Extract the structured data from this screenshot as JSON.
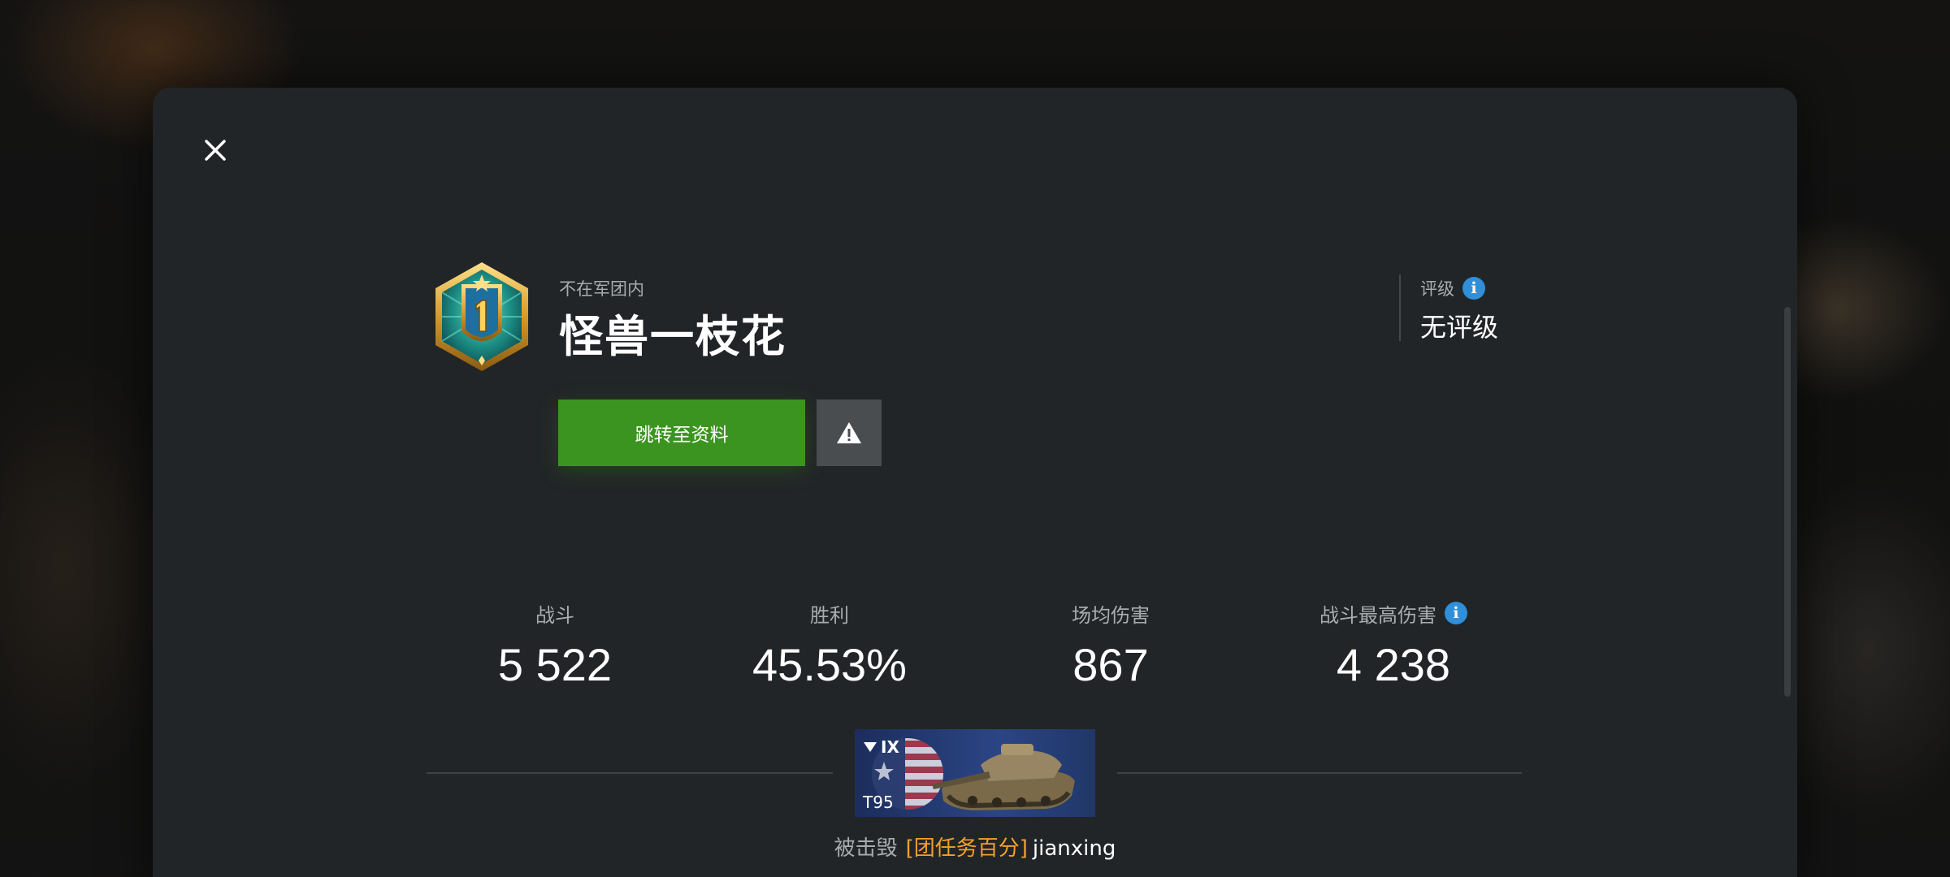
{
  "header": {
    "clan_status": "不在军团内",
    "player_name": "怪兽一枝花",
    "emblem_rank": "1"
  },
  "rating": {
    "label": "评级",
    "value": "无评级"
  },
  "actions": {
    "profile_label": "跳转至资料"
  },
  "stats": [
    {
      "label": "战斗",
      "value": "5 522"
    },
    {
      "label": "胜利",
      "value": "45.53%"
    },
    {
      "label": "场均伤害",
      "value": "867"
    },
    {
      "label": "战斗最高伤害",
      "value": "4 238"
    }
  ],
  "tank": {
    "tier": "IX",
    "name": "T95"
  },
  "destroyed_by": {
    "label": "被击毁",
    "clan": "[团任务百分]",
    "player": "jianxing"
  },
  "colors": {
    "accent_green": "#3b9420",
    "info_blue": "#2f8fd8",
    "clan_orange": "#f3a02b"
  },
  "icons": [
    "close-icon",
    "rank-emblem-icon",
    "warning-icon",
    "info-icon",
    "tank-icon",
    "us-flag-icon"
  ]
}
